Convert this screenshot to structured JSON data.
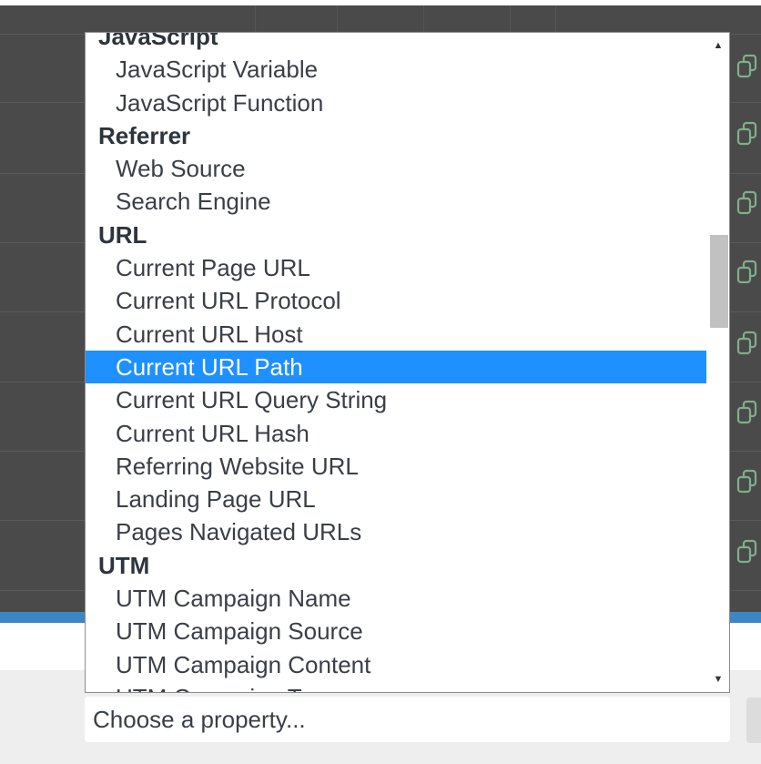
{
  "dropdown": {
    "options": [
      {
        "label": "JavaScript",
        "type": "group"
      },
      {
        "label": "JavaScript Variable",
        "type": "item"
      },
      {
        "label": "JavaScript Function",
        "type": "item"
      },
      {
        "label": "Referrer",
        "type": "group"
      },
      {
        "label": "Web Source",
        "type": "item"
      },
      {
        "label": "Search Engine",
        "type": "item"
      },
      {
        "label": "URL",
        "type": "group"
      },
      {
        "label": "Current Page URL",
        "type": "item"
      },
      {
        "label": "Current URL Protocol",
        "type": "item"
      },
      {
        "label": "Current URL Host",
        "type": "item"
      },
      {
        "label": "Current URL Path",
        "type": "item",
        "selected": true
      },
      {
        "label": "Current URL Query String",
        "type": "item"
      },
      {
        "label": "Current URL Hash",
        "type": "item"
      },
      {
        "label": "Referring Website URL",
        "type": "item"
      },
      {
        "label": "Landing Page URL",
        "type": "item"
      },
      {
        "label": "Pages Navigated URLs",
        "type": "item"
      },
      {
        "label": "UTM",
        "type": "group"
      },
      {
        "label": "UTM Campaign Name",
        "type": "item"
      },
      {
        "label": "UTM Campaign Source",
        "type": "item"
      },
      {
        "label": "UTM Campaign Content",
        "type": "item"
      },
      {
        "label": "UTM Campaign Term",
        "type": "item"
      }
    ],
    "scroll_up_icon": "triangle-up-icon",
    "scroll_down_icon": "triangle-down-icon"
  },
  "select": {
    "placeholder": "Choose a property..."
  },
  "background": {
    "row_icon": "duplicate-icon"
  },
  "colors": {
    "selected_bg": "#1e90ff",
    "accent_bar": "#3d86c6",
    "overlay": "#4a4a4a"
  }
}
